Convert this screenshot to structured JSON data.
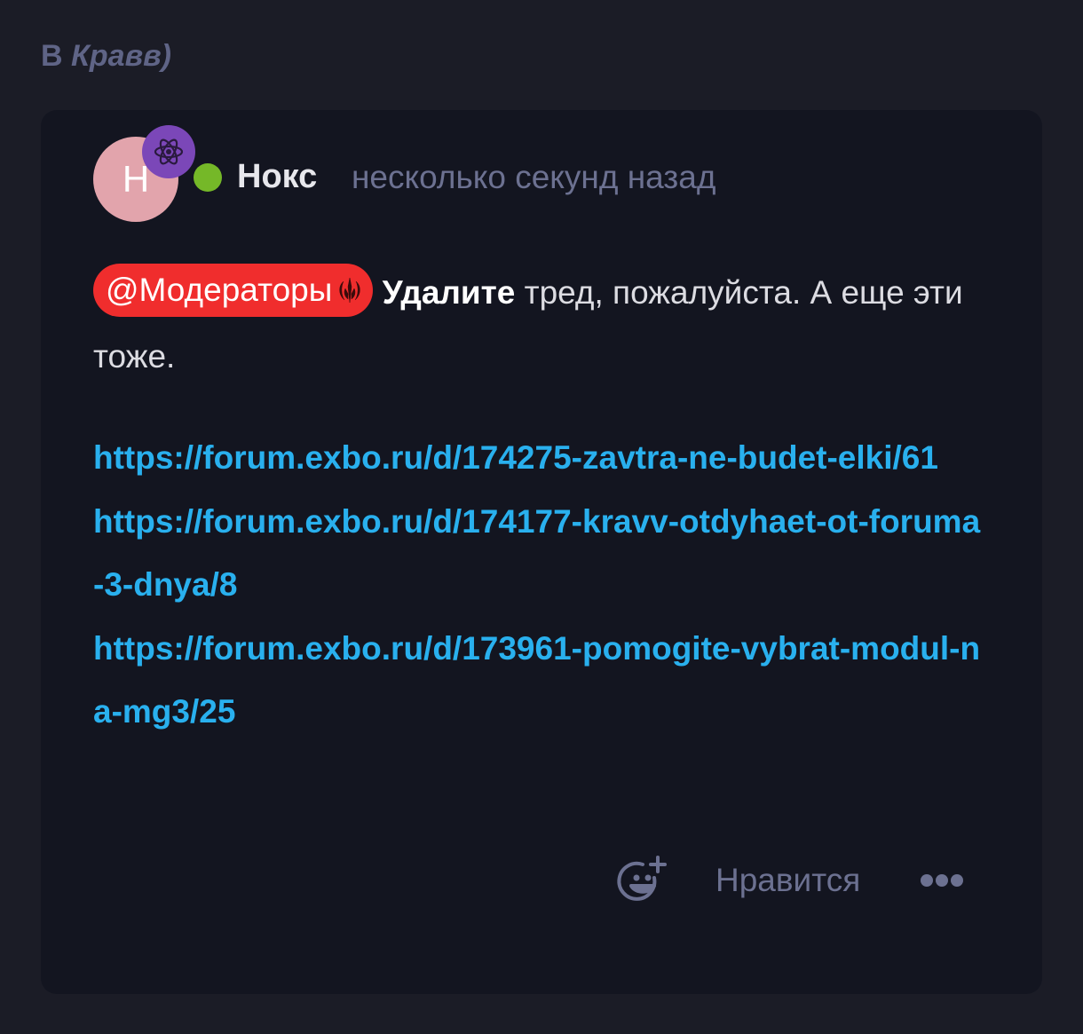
{
  "header": {
    "prefix": "В ",
    "name": "Кравв)"
  },
  "post": {
    "avatar_letter": "Н",
    "avatar_color": "#e2a4ac",
    "badge_icon": "react-atom-icon",
    "badge_color": "#7b47b8",
    "online_color": "#75b828",
    "username": "Нокс",
    "timestamp": "несколько секунд назад",
    "mention": {
      "label": "@Модераторы",
      "icon": "jedi-order-icon",
      "color": "#f02d2d"
    },
    "bold_word": "Удалите",
    "text_rest": " тред, пожалуйста. А еще эти тоже.",
    "links": [
      "https://forum.exbo.ru/d/174275-zavtra-ne-budet-elki/61",
      "https://forum.exbo.ru/d/174177-kravv-otdyhaet-ot-foruma-3-dnya/8",
      "https://forum.exbo.ru/d/173961-pomogite-vybrat-modul-na-mg3/25"
    ],
    "link_color": "#29b0ee",
    "actions": {
      "react_icon": "add-reaction-icon",
      "like_label": "Нравится",
      "more_icon": "more-dots-icon"
    }
  }
}
